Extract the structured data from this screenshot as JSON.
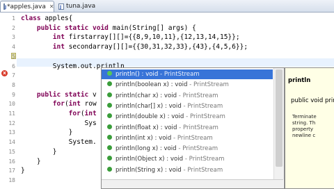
{
  "tabs": [
    {
      "label": "*apples.java",
      "close": "✕"
    },
    {
      "label": "tuna.java",
      "close": ""
    }
  ],
  "code": {
    "lines": [
      {
        "num": "1",
        "text": "class apples{"
      },
      {
        "num": "2",
        "text": "    public static void main(String[] args) {"
      },
      {
        "num": "3",
        "text": "        int firstarray[][]={{8,9,10,11},{12,13,14,15}};"
      },
      {
        "num": "4",
        "text": "        int secondarray[][]={{30,31,32,33},{43},{4,5,6}};"
      },
      {
        "num": "5",
        "text": ""
      },
      {
        "num": "6",
        "text": "        System.out.println"
      },
      {
        "num": "7",
        "text": ""
      },
      {
        "num": "8",
        "text": ""
      },
      {
        "num": "9",
        "text": "    public static v"
      },
      {
        "num": "10",
        "text": "        for(int row"
      },
      {
        "num": "11",
        "text": "            for(int"
      },
      {
        "num": "12",
        "text": "                Sys"
      },
      {
        "num": "13",
        "text": "            }"
      },
      {
        "num": "14",
        "text": "            System."
      },
      {
        "num": "15",
        "text": "        }"
      },
      {
        "num": "16",
        "text": "    }"
      },
      {
        "num": "17",
        "text": "}"
      },
      {
        "num": "18",
        "text": ""
      }
    ]
  },
  "autocomplete": {
    "items": [
      {
        "name": "println() : void",
        "type": "PrintStream"
      },
      {
        "name": "println(boolean x) : void",
        "type": "PrintStream"
      },
      {
        "name": "println(char x) : void",
        "type": "PrintStream"
      },
      {
        "name": "println(char[] x) : void",
        "type": "PrintStream"
      },
      {
        "name": "println(double x) : void",
        "type": "PrintStream"
      },
      {
        "name": "println(float x) : void",
        "type": "PrintStream"
      },
      {
        "name": "println(int x) : void",
        "type": "PrintStream"
      },
      {
        "name": "println(long x) : void",
        "type": "PrintStream"
      },
      {
        "name": "println(Object x) : void",
        "type": "PrintStream"
      },
      {
        "name": "println(String x) : void",
        "type": "PrintStream"
      }
    ],
    "selected_index": 0
  },
  "javadoc": {
    "title": "println",
    "signature": "public void println()",
    "desc_lines": [
      "Terminate",
      "string. Th",
      "property",
      "newline c"
    ]
  },
  "colors": {
    "keyword": "#7f0055",
    "selection": "#3874d8",
    "method_dot": "#3a9d3a",
    "doc_bg": "#ffffe6"
  }
}
